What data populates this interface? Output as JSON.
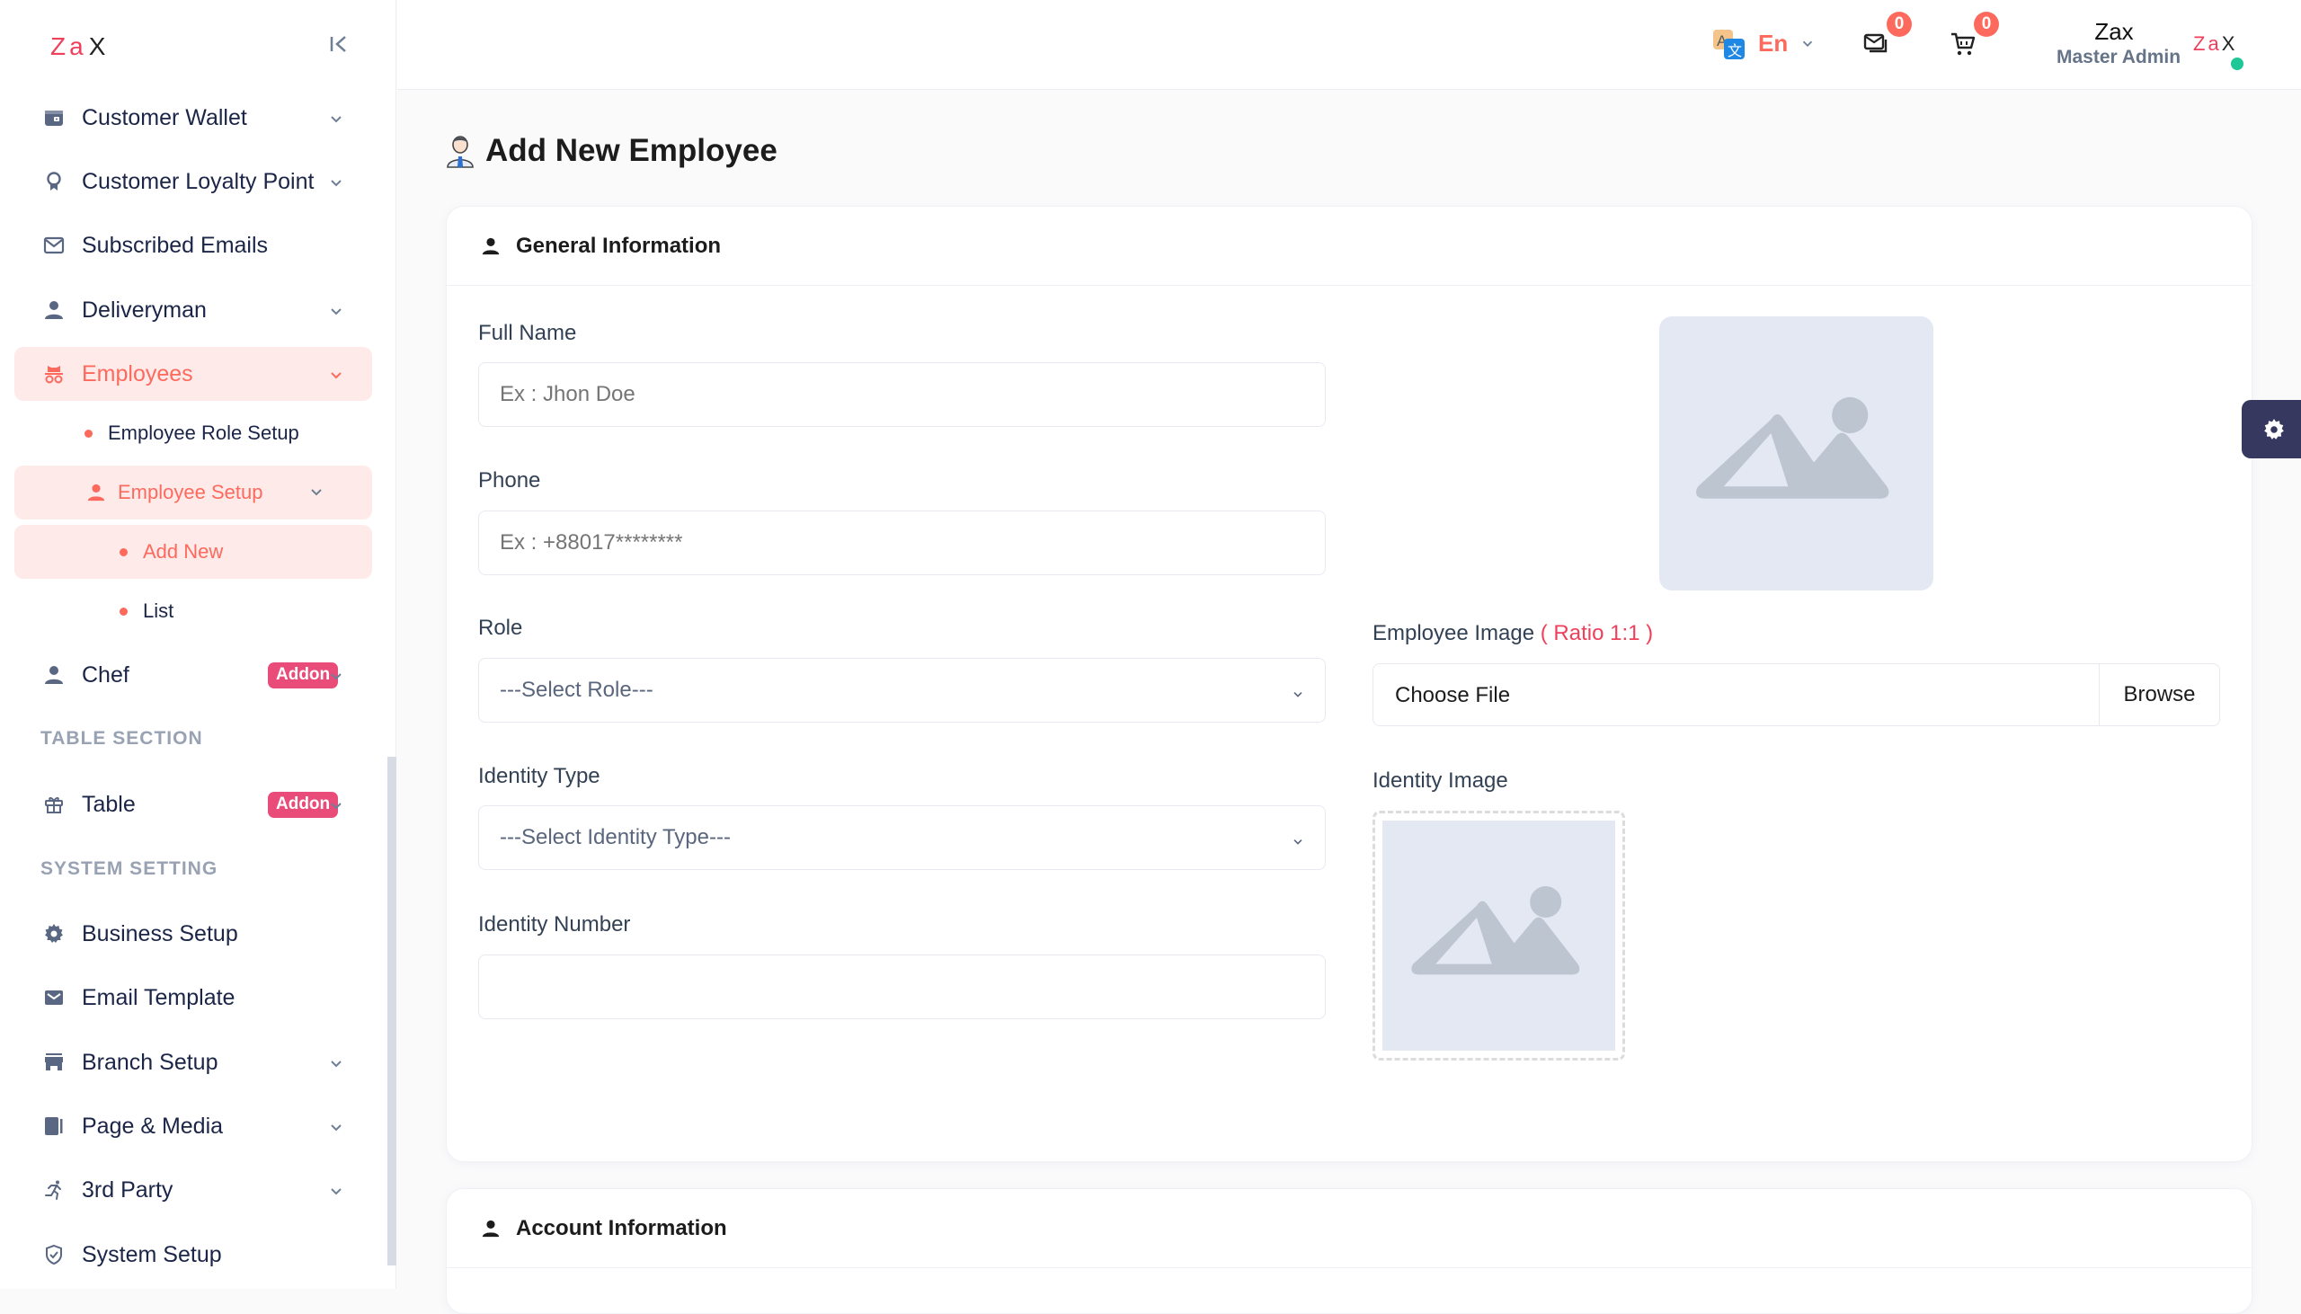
{
  "brand": {
    "logo_text": "Za",
    "logo_mark": "X",
    "accent": "#fd6a5d",
    "brand_red": "#ef3f5a"
  },
  "sidebar": {
    "items": [
      {
        "label": "Customer Wallet",
        "icon": "wallet-icon",
        "has_chevron": true
      },
      {
        "label": "Customer Loyalty Point",
        "icon": "award-icon",
        "has_chevron": true
      },
      {
        "label": "Subscribed Emails",
        "icon": "envelope-icon",
        "has_chevron": false
      },
      {
        "label": "Deliveryman",
        "icon": "user-icon",
        "has_chevron": true
      },
      {
        "label": "Employees",
        "icon": "incognito-icon",
        "has_chevron": true,
        "active": true
      }
    ],
    "employees_sub": {
      "role_setup": "Employee Role Setup",
      "employee_setup": "Employee Setup",
      "add_new": "Add New",
      "list": "List"
    },
    "chef": {
      "label": "Chef",
      "badge": "Addon"
    },
    "table_section_title": "TABLE SECTION",
    "table": {
      "label": "Table",
      "badge": "Addon"
    },
    "system_setting_title": "SYSTEM SETTING",
    "system_items": [
      {
        "label": "Business Setup",
        "icon": "gear-icon",
        "has_chevron": false
      },
      {
        "label": "Email Template",
        "icon": "mail-icon",
        "has_chevron": false
      },
      {
        "label": "Branch Setup",
        "icon": "store-icon",
        "has_chevron": true
      },
      {
        "label": "Page & Media",
        "icon": "page-icon",
        "has_chevron": true
      },
      {
        "label": "3rd Party",
        "icon": "runner-icon",
        "has_chevron": true
      },
      {
        "label": "System Setup",
        "icon": "shield-check-icon",
        "has_chevron": false
      }
    ]
  },
  "header": {
    "language": "En",
    "messages_count": "0",
    "cart_count": "0",
    "user_name": "Zax",
    "user_role": "Master Admin",
    "online_status_color": "#1ec796"
  },
  "page": {
    "title": "Add New Employee",
    "general_info": {
      "title": "General Information",
      "full_name_label": "Full Name",
      "full_name_placeholder": "Ex : Jhon Doe",
      "full_name_value": "",
      "phone_label": "Phone",
      "phone_placeholder": "Ex : +88017********",
      "phone_value": "",
      "role_label": "Role",
      "role_selected": "---Select Role---",
      "identity_type_label": "Identity Type",
      "identity_type_selected": "---Select Identity Type---",
      "identity_number_label": "Identity Number",
      "identity_number_value": "",
      "employee_image_label": "Employee Image",
      "employee_image_ratio": "( Ratio 1:1 )",
      "file_choose_text": "Choose File",
      "file_browse_text": "Browse",
      "identity_image_label": "Identity Image"
    },
    "account_info": {
      "title": "Account Information"
    }
  }
}
